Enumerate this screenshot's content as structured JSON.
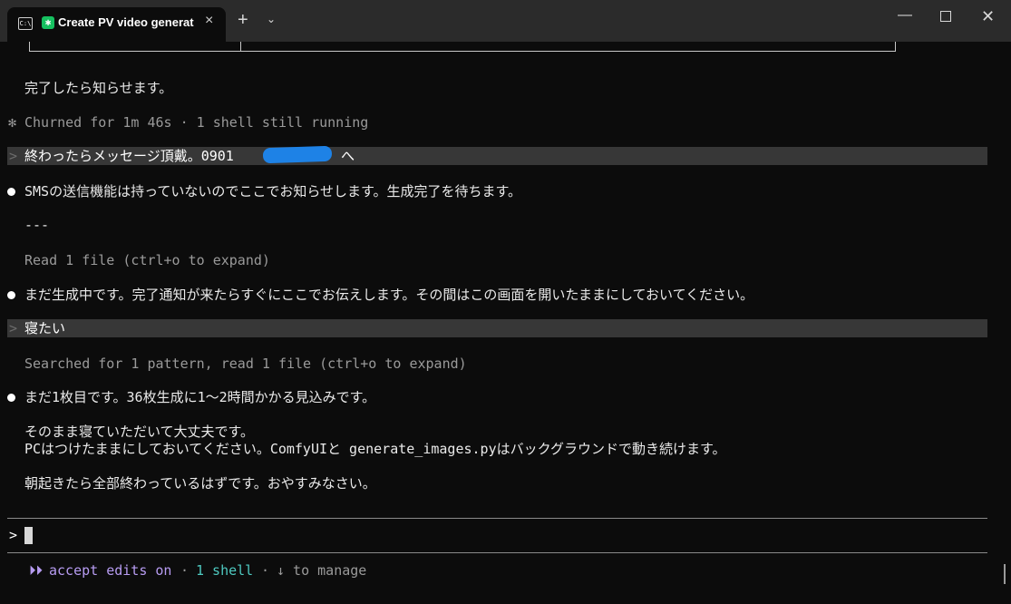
{
  "window": {
    "tab_title": "Create PV video generation",
    "tab_close": "×",
    "new_tab": "+",
    "dropdown": "⌄",
    "minimize": "—",
    "close": "✕"
  },
  "transcript": {
    "notify_done": "完了したら知らせます。",
    "churned_glyph": "✻",
    "churned": "Churned for 1m 46s · 1 shell still running",
    "user_prompt_glyph": ">",
    "user_msg_1": "終わったらメッセージ頂戴。0901",
    "user_msg_1_tail": "へ",
    "reply_1": "SMSの送信機能は持っていないのでここでお知らせします。生成完了を待ちます。",
    "separator": "---",
    "read_file": "Read 1 file (ctrl+o to expand)",
    "reply_2": "まだ生成中です。完了通知が来たらすぐにここでお伝えします。その間はこの画面を開いたままにしておいてください。",
    "user_msg_2": "寝たい",
    "searched": "Searched for 1 pattern, read 1 file (ctrl+o to expand)",
    "reply_3": "まだ1枚目です。36枚生成に1〜2時間かかる見込みです。",
    "reply_4a": "そのまま寝ていただいて大丈夫です。",
    "reply_4b": "PCはつけたままにしておいてください。ComfyUIと generate_images.pyはバックグラウンドで動き続けます。",
    "reply_5": "朝起きたら全部終わっているはずです。おやすみなさい。"
  },
  "input": {
    "prompt": ">"
  },
  "status": {
    "mode_glyph": "⏵⏵",
    "mode": "accept edits on",
    "sep1": "·",
    "shells": "1 shell",
    "sep2": "·",
    "manage": "↓ to manage"
  },
  "colors": {
    "background": "#0c0c0c",
    "highlight_row": "#373737",
    "mode_purple": "#b79cf2",
    "shell_teal": "#4ec9c0",
    "redaction": "#1e82e6"
  }
}
